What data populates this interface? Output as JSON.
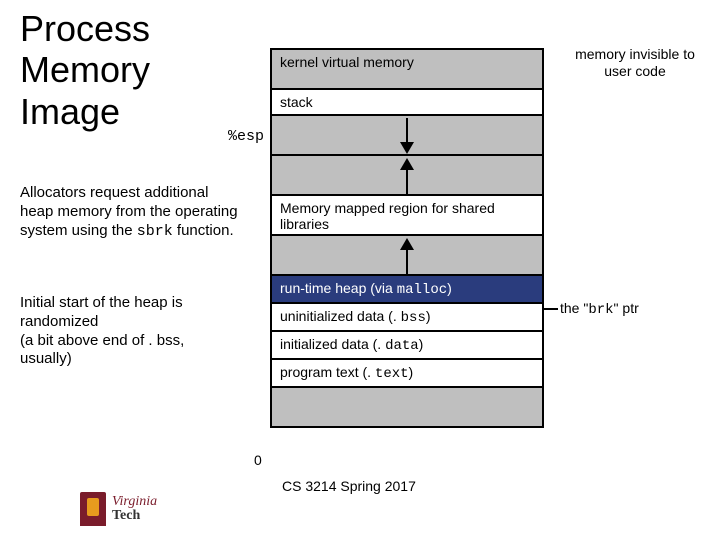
{
  "title_line1": "Process",
  "title_line2": "Memory",
  "title_line3": "Image",
  "para1_a": "Allocators request additional heap memory from the operating system using the ",
  "para1_code": "sbrk",
  "para1_b": " function.",
  "para2_a": "Initial start of the heap is randomized",
  "para2_b": "(a bit above end of . bss, usually)",
  "segments": {
    "kernel": "kernel virtual memory",
    "stack": "stack",
    "mmap": "Memory mapped region for shared libraries",
    "heap_a": "run-time heap (via ",
    "heap_code": "malloc",
    "heap_b": ")",
    "bss_a": "uninitialized data (. ",
    "bss_code": "bss",
    "bss_b": ")",
    "data_a": "initialized data (. ",
    "data_code": "data",
    "data_b": ")",
    "text_a": "program text (. ",
    "text_code": "text",
    "text_b": ")"
  },
  "labels": {
    "esp": "%esp",
    "note_top": "memory invisible to user code",
    "brk_a": "the \"",
    "brk_code": "brk",
    "brk_b": "\" ptr",
    "zero": "0"
  },
  "footer": "CS 3214 Spring 2017",
  "logo": {
    "v": "Virginia",
    "t": "Tech"
  }
}
